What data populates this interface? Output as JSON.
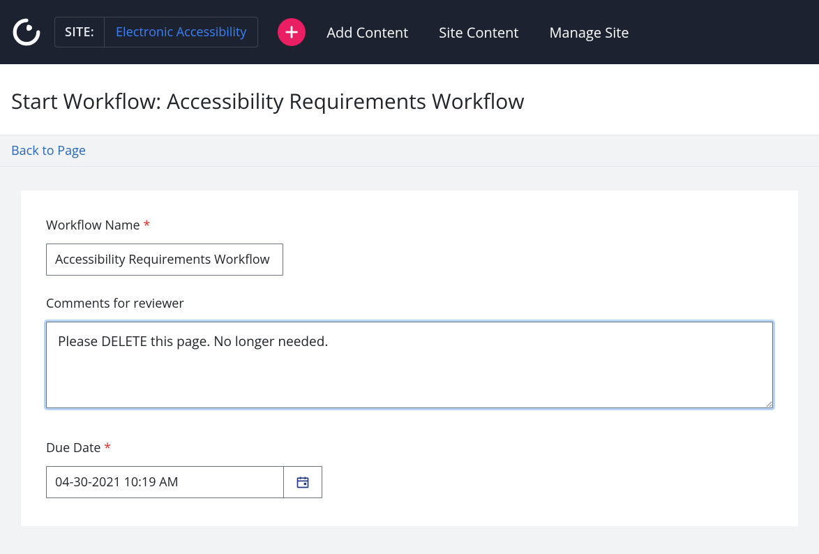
{
  "topbar": {
    "site_label": "SITE:",
    "site_name": "Electronic Accessibility",
    "nav": {
      "add_content": "Add Content",
      "site_content": "Site Content",
      "manage_site": "Manage Site"
    }
  },
  "page": {
    "title": "Start Workflow: Accessibility Requirements Workflow",
    "back_link": "Back to Page"
  },
  "form": {
    "workflow_name": {
      "label": "Workflow Name",
      "value": "Accessibility Requirements Workflow"
    },
    "comments": {
      "label": "Comments for reviewer",
      "value": "Please DELETE this page. No longer needed."
    },
    "due_date": {
      "label": "Due Date",
      "value": "04-30-2021 10:19 AM"
    }
  }
}
